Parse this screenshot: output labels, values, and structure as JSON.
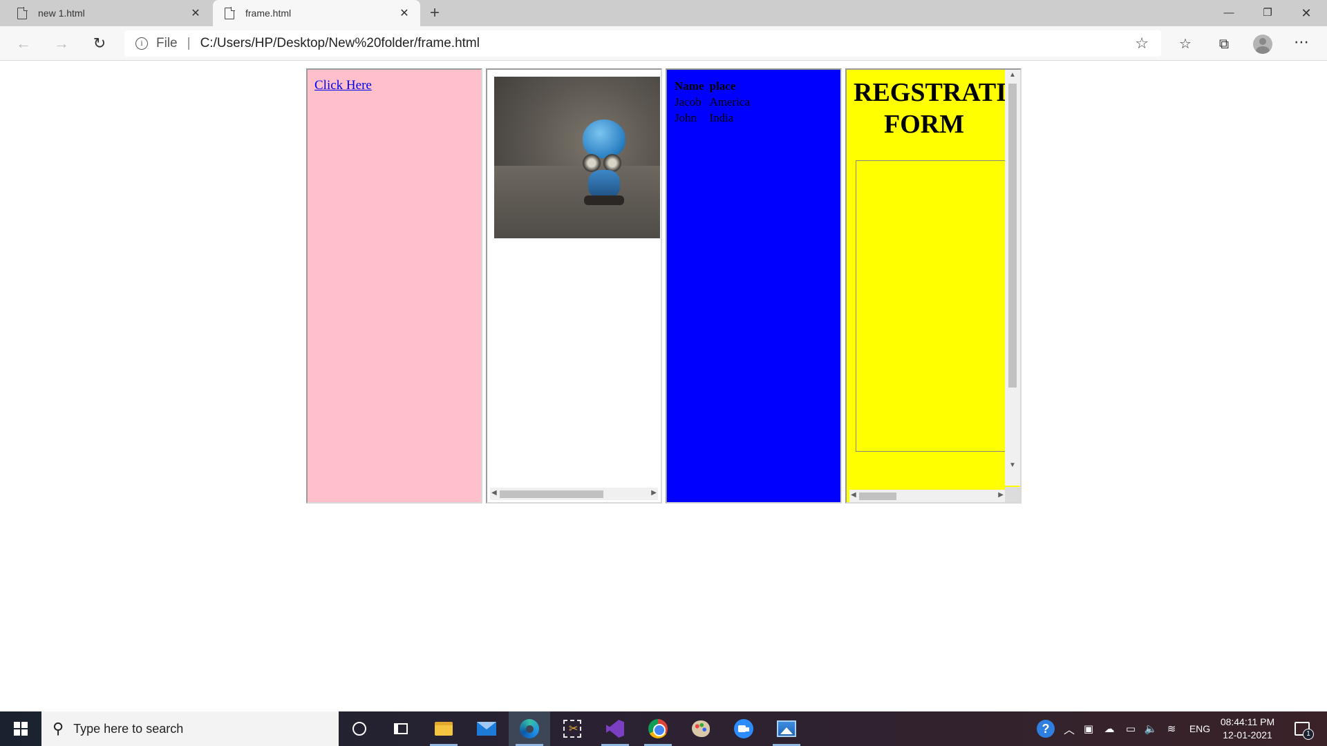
{
  "browser": {
    "tabs": [
      {
        "title": "new 1.html",
        "icon": "page-icon",
        "active": false
      },
      {
        "title": "frame.html",
        "icon": "page-icon",
        "active": true
      }
    ],
    "new_tab_glyph": "+",
    "address": {
      "scheme_label": "File",
      "separator": "|",
      "url": "C:/Users/HP/Desktop/New%20folder/frame.html"
    }
  },
  "page": {
    "frame1": {
      "background": "#ffc0cb",
      "link_text": "Click Here"
    },
    "frame2": {
      "image_icon": "robot-toy-photo"
    },
    "frame3": {
      "background": "#0000ff",
      "table_headers": [
        "Name",
        "place"
      ],
      "table_rows": [
        [
          "Jacob",
          "America"
        ],
        [
          "John",
          "India"
        ]
      ]
    },
    "frame4": {
      "background": "#ffff00",
      "title_line1": "REGSTRATION",
      "title_line2": "FORM"
    }
  },
  "taskbar": {
    "search_placeholder": "Type here to search",
    "pinned_apps": [
      "cortana",
      "task-view",
      "file-explorer",
      "mail",
      "edge",
      "snipping-tool",
      "visual-studio",
      "chrome",
      "paint",
      "zoom",
      "photos"
    ],
    "language": "ENG",
    "time": "08:44:11 PM",
    "date": "12-01-2021",
    "notification_count": "1"
  }
}
